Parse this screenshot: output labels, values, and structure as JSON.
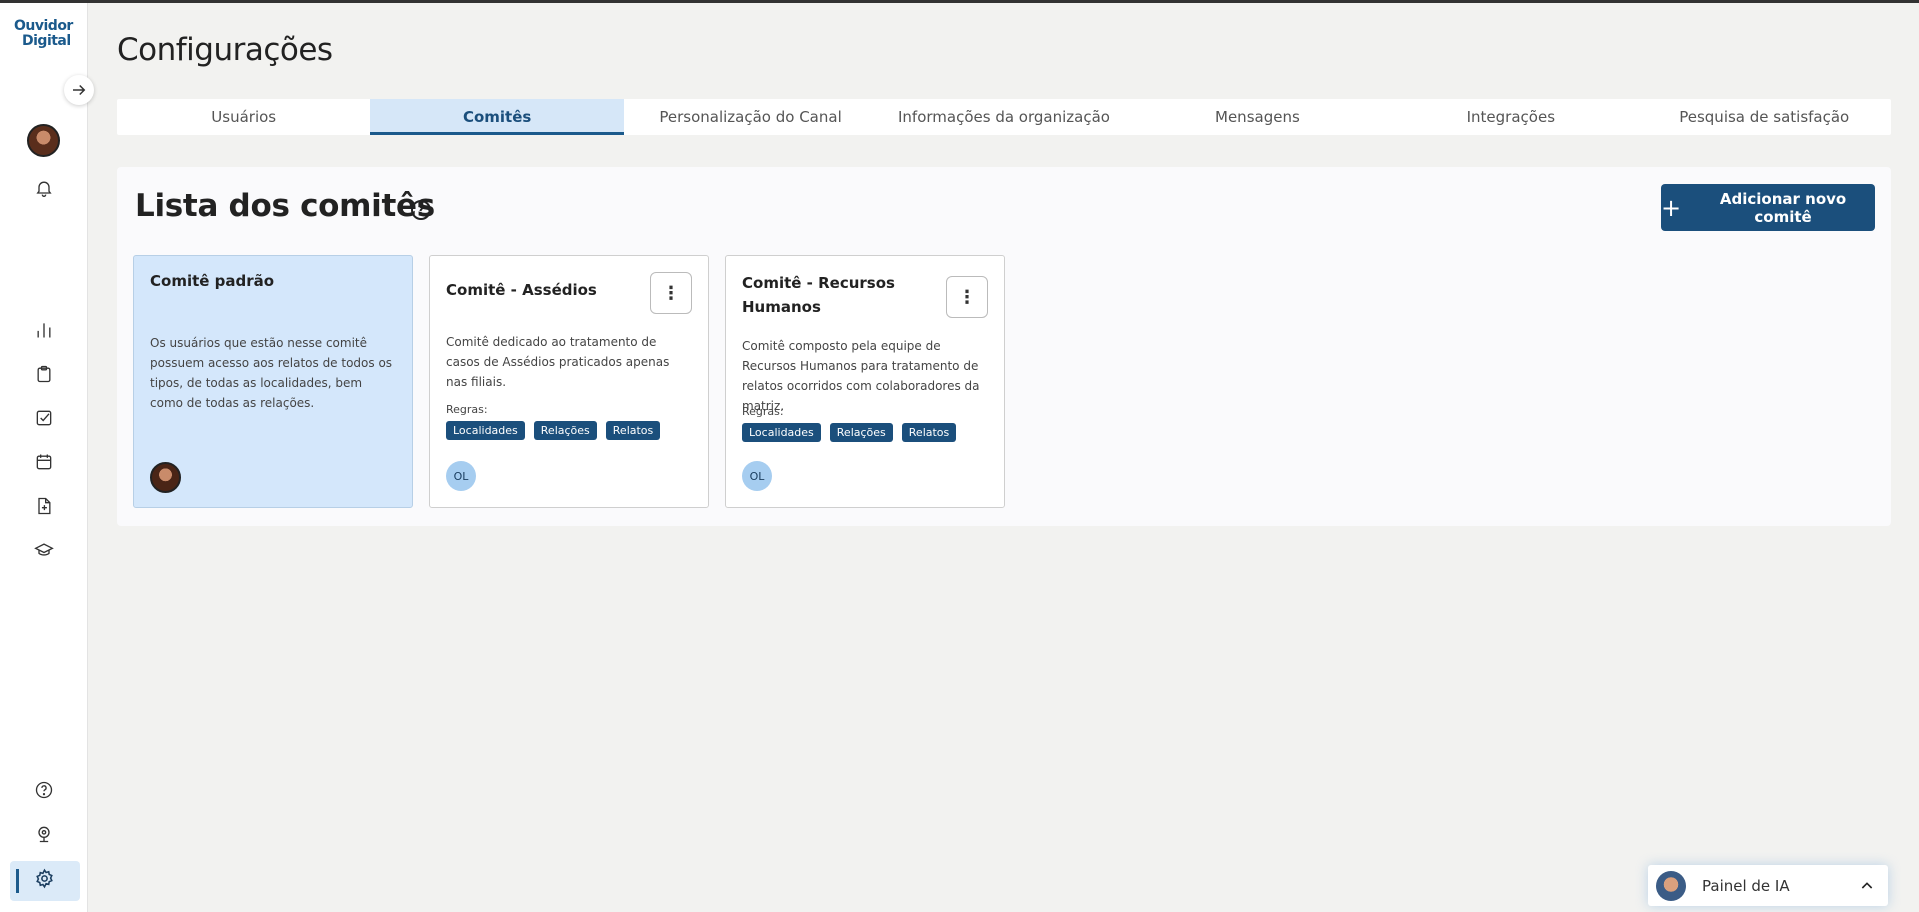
{
  "brand": {
    "line1": "Ouvidor",
    "line2": "Digital"
  },
  "page": {
    "title": "Configurações"
  },
  "tabs": [
    {
      "label": "Usuários"
    },
    {
      "label": "Comitês"
    },
    {
      "label": "Personalização do Canal"
    },
    {
      "label": "Informações da organização"
    },
    {
      "label": "Mensagens"
    },
    {
      "label": "Integrações"
    },
    {
      "label": "Pesquisa de satisfação"
    }
  ],
  "active_tab": "Comitês",
  "list": {
    "title": "Lista dos comitês",
    "help_glyph": "?",
    "add_button": {
      "plus": "+",
      "label": "Adicionar novo comitê"
    }
  },
  "committees": [
    {
      "title": "Comitê padrão",
      "description": "Os usuários que estão nesse comitê possuem acesso aos relatos de todos os tipos, de todas as localidades, bem como de todas as relações."
    },
    {
      "title": "Comitê - Assédios",
      "description": "Comitê dedicado ao tratamento de casos de Assédios praticados apenas nas filiais.",
      "rules_label": "Regras:",
      "rules": [
        "Localidades",
        "Relações",
        "Relatos"
      ],
      "member_initials": "OL",
      "menu_glyph": "⋮"
    },
    {
      "title": "Comitê - Recursos Humanos",
      "description": "Comitê composto pela equipe de Recursos Humanos para tratamento de relatos ocorridos com colaboradores da matriz.",
      "rules_label": "Regras:",
      "rules": [
        "Localidades",
        "Relações",
        "Relatos"
      ],
      "member_initials": "OL",
      "menu_glyph": "⋮"
    }
  ],
  "ai_panel": {
    "label": "Painel de IA"
  },
  "colors": {
    "primary": "#1b4f7c",
    "active_tab_bg": "#d6e7f8",
    "default_card_bg": "#d4e7fb",
    "chip": "#1b4f7c"
  },
  "icons": [
    "arrow-right-icon",
    "bell-icon",
    "bar-chart-icon",
    "clipboard-icon",
    "checkbox-icon",
    "calendar-icon",
    "file-plus-icon",
    "graduation-cap-icon",
    "help-icon",
    "webcam-icon",
    "gear-icon",
    "chevron-up-icon"
  ]
}
